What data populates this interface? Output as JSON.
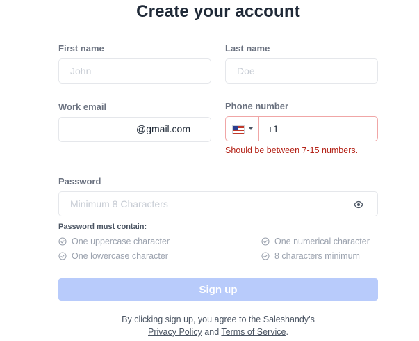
{
  "title": "Create your account",
  "first_name": {
    "label": "First name",
    "placeholder": "John",
    "value": ""
  },
  "last_name": {
    "label": "Last name",
    "placeholder": "Doe",
    "value": ""
  },
  "work_email": {
    "label": "Work email",
    "value": "@gmail.com"
  },
  "phone": {
    "label": "Phone number",
    "country_flag_icon": "us-flag-icon",
    "value": "+1",
    "error": "Should be between 7-15 numbers.",
    "error_color": "#b42318",
    "border_color": "#f0a6a6"
  },
  "password": {
    "label": "Password",
    "placeholder": "Minimum 8 Characters",
    "toggle_icon": "eye-icon",
    "requirements_title": "Password must contain:",
    "requirements": [
      "One uppercase character",
      "One lowercase character",
      "One numerical character",
      "8 characters minimum"
    ]
  },
  "signup": {
    "label": "Sign up",
    "color": "#b8cbfb"
  },
  "terms": {
    "prefix": "By clicking sign up, you agree to the Saleshandy’s",
    "privacy_label": "Privacy Policy",
    "and": "and",
    "terms_label": "Terms of Service",
    "suffix": "."
  }
}
